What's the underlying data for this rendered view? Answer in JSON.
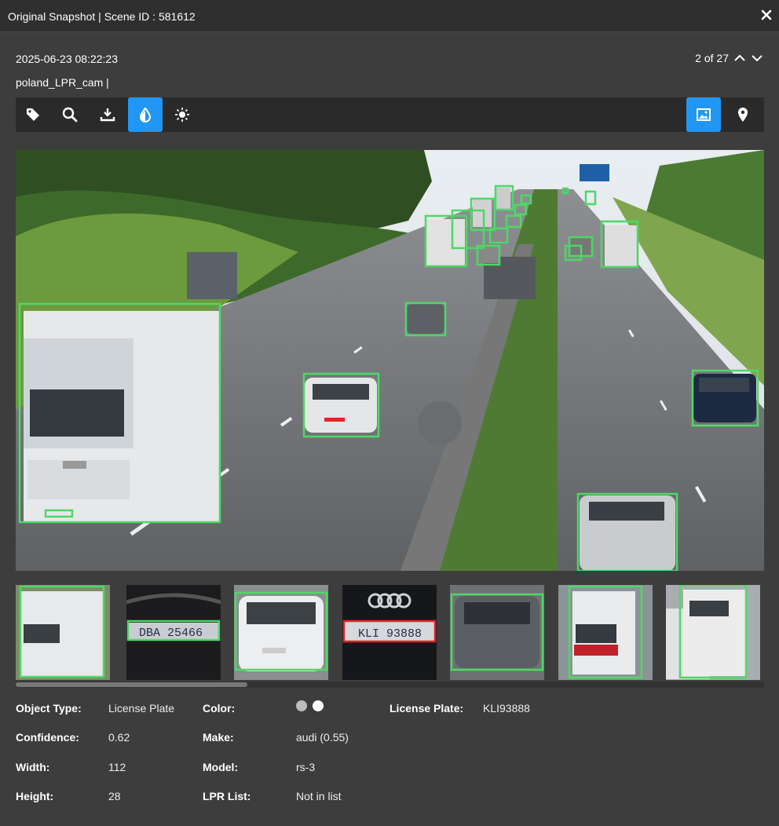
{
  "window": {
    "title": "Original Snapshot | Scene ID : 581612"
  },
  "header": {
    "timestamp": "2025-06-23 08:22:23",
    "camera": "poland_LPR_cam |",
    "pager": "2 of 27"
  },
  "toolbar": {
    "left_icons": [
      "tag-icon",
      "search-zoom-icon",
      "download-icon",
      "contrast-drop-icon",
      "brightness-icon"
    ],
    "right_icons": [
      "image-icon",
      "location-pin-icon"
    ],
    "accent": "#2196f3"
  },
  "viewer": {
    "scene": "highway traffic snapshot with detection boxes",
    "box_color": "#4cd964",
    "selected_color": "#e8202a"
  },
  "thumbnails": {
    "plates": [
      "DBA 25466",
      "KLI 93888"
    ],
    "scroll_fraction": 0.31
  },
  "details": {
    "object_type_label": "Object Type:",
    "object_type_value": "License Plate",
    "confidence_label": "Confidence:",
    "confidence_value": "0.62",
    "width_label": "Width:",
    "width_value": "112",
    "height_label": "Height:",
    "height_value": "28",
    "color_label": "Color:",
    "colors": [
      "#bdbdbd",
      "#ffffff"
    ],
    "make_label": "Make:",
    "make_value": "audi (0.55)",
    "model_label": "Model:",
    "model_value": "rs-3",
    "lpr_list_label": "LPR List:",
    "lpr_list_value": "Not in list",
    "plate_label": "License Plate:",
    "plate_value": "KLI93888"
  }
}
